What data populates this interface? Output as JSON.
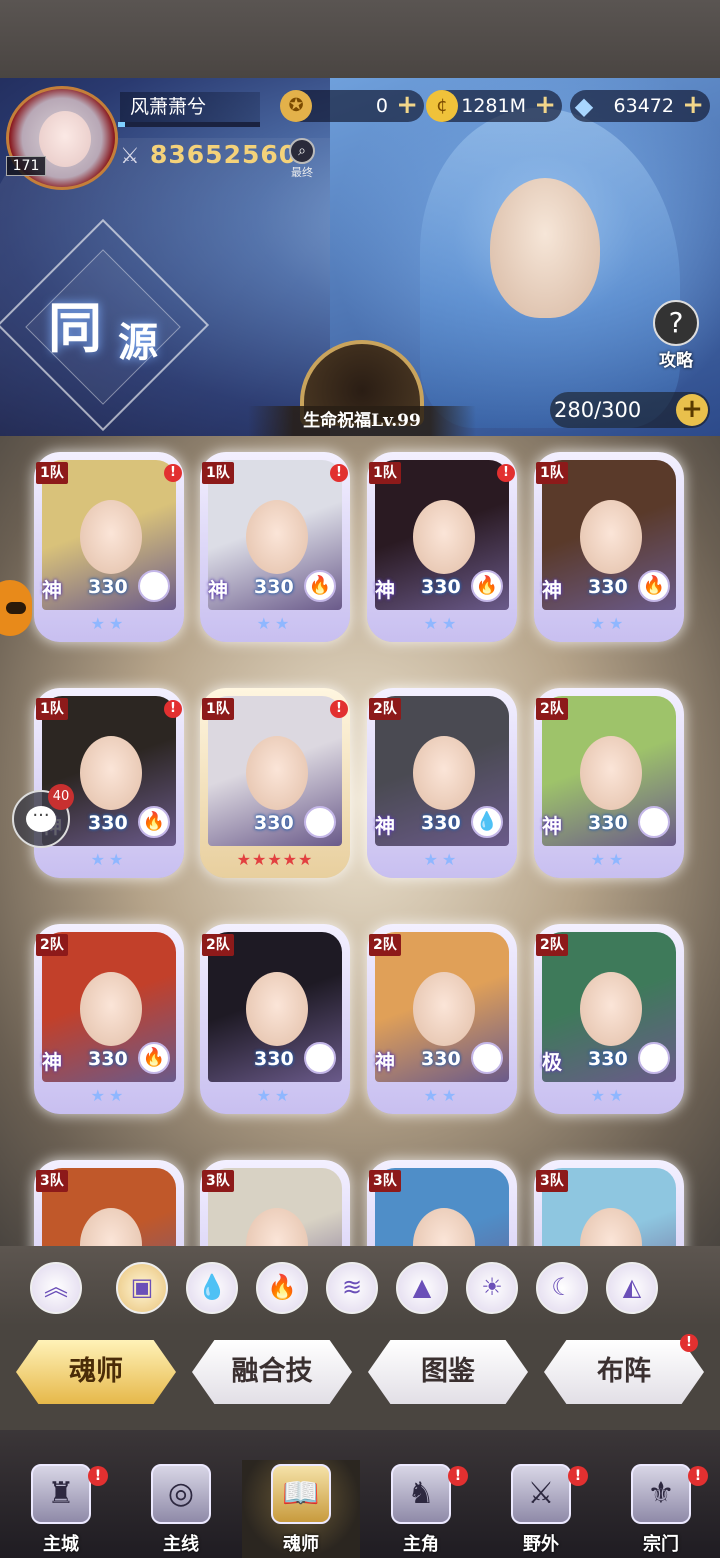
{
  "player": {
    "name": "风萧萧兮",
    "level": "171",
    "power": "83652560",
    "rank_icon": "magnifier-icon",
    "rank_label": "最终",
    "exp_progress": 0.05
  },
  "currencies": [
    {
      "icon": "medal-icon",
      "value": "0",
      "plus": "+"
    },
    {
      "icon": "gold-coin-icon",
      "value": "1281M",
      "plus": "+"
    },
    {
      "icon": "diamond-icon",
      "value": "63472",
      "plus": "+"
    }
  ],
  "banner": {
    "title_char1": "同",
    "title_char2": "源",
    "guide_label": "攻略",
    "guide_icon": "?",
    "blessing": "生命祝福Lv.99",
    "capacity": "280/300",
    "capacity_plus": "+"
  },
  "cards": [
    {
      "team": "1队",
      "grade": "神",
      "level": "330",
      "element": "sun-icon",
      "elem_glyph": "☀",
      "stars": "★★",
      "alert": "!",
      "hair": "#d9c27a"
    },
    {
      "team": "1队",
      "grade": "神",
      "level": "330",
      "element": "fire-icon",
      "elem_glyph": "🔥",
      "stars": "★★",
      "alert": "!",
      "hair": "#dcdde6"
    },
    {
      "team": "1队",
      "grade": "神",
      "level": "330",
      "element": "fire-icon",
      "elem_glyph": "🔥",
      "stars": "★★",
      "alert": "!",
      "hair": "#2a1a22"
    },
    {
      "team": "1队",
      "grade": "神",
      "level": "330",
      "element": "fire-icon",
      "elem_glyph": "🔥",
      "stars": "★★",
      "alert": "",
      "hair": "#5a3a2a"
    },
    {
      "team": "1队",
      "grade": "神",
      "level": "330",
      "element": "fire-icon",
      "elem_glyph": "🔥",
      "stars": "★★",
      "alert": "!",
      "hair": "#2c2622"
    },
    {
      "team": "1队",
      "grade": "",
      "level": "330",
      "element": "moon-icon",
      "elem_glyph": "☾",
      "stars": "★★★★★",
      "alert": "!",
      "hair": "#dcd8e0",
      "gold": true
    },
    {
      "team": "2队",
      "grade": "神",
      "level": "330",
      "element": "water-icon",
      "elem_glyph": "💧",
      "stars": "★★",
      "alert": "",
      "hair": "#4a4a52"
    },
    {
      "team": "2队",
      "grade": "神",
      "level": "330",
      "element": "wind-icon",
      "elem_glyph": "≋",
      "stars": "★★",
      "alert": "",
      "hair": "#9ec36a"
    },
    {
      "team": "2队",
      "grade": "神",
      "level": "330",
      "element": "fire-icon",
      "elem_glyph": "🔥",
      "stars": "★★",
      "alert": "",
      "hair": "#c2402a"
    },
    {
      "team": "2队",
      "grade": "",
      "level": "330",
      "element": "wind-icon",
      "elem_glyph": "≋",
      "stars": "★★",
      "alert": "",
      "hair": "#1e1a24"
    },
    {
      "team": "2队",
      "grade": "神",
      "level": "330",
      "element": "wind-icon",
      "elem_glyph": "≋",
      "stars": "★★",
      "alert": "",
      "hair": "#e0a058"
    },
    {
      "team": "2队",
      "grade": "极",
      "level": "330",
      "element": "wind-icon",
      "elem_glyph": "≋",
      "stars": "★★",
      "alert": "",
      "hair": "#3e7a5a"
    },
    {
      "team": "3队",
      "grade": "",
      "level": "",
      "element": "",
      "elem_glyph": "",
      "stars": "",
      "alert": "",
      "hair": "#c0582a"
    },
    {
      "team": "3队",
      "grade": "",
      "level": "",
      "element": "",
      "elem_glyph": "",
      "stars": "",
      "alert": "",
      "hair": "#d8d2c4"
    },
    {
      "team": "3队",
      "grade": "",
      "level": "",
      "element": "",
      "elem_glyph": "",
      "stars": "",
      "alert": "",
      "hair": "#4f8ec8"
    },
    {
      "team": "3队",
      "grade": "",
      "level": "",
      "element": "",
      "elem_glyph": "",
      "stars": "",
      "alert": "",
      "hair": "#8ec6e0"
    }
  ],
  "side": {
    "chat_icon": "chat-bubble-icon",
    "chat_count": "40",
    "chat_glyph": "···"
  },
  "filters": [
    {
      "name": "rank-chevron-icon",
      "glyph": "︽"
    },
    {
      "name": "all-box-icon",
      "glyph": "▣",
      "active": true
    },
    {
      "name": "water-filter-icon",
      "glyph": "💧"
    },
    {
      "name": "fire-filter-icon",
      "glyph": "🔥"
    },
    {
      "name": "wind-filter-icon",
      "glyph": "≋"
    },
    {
      "name": "earth-filter-icon",
      "glyph": "▲"
    },
    {
      "name": "sun-filter-icon",
      "glyph": "☀"
    },
    {
      "name": "moon-filter-icon",
      "glyph": "☾"
    },
    {
      "name": "void-filter-icon",
      "glyph": "◭"
    }
  ],
  "tabs": [
    {
      "label": "魂师",
      "active": true,
      "alert": ""
    },
    {
      "label": "融合技",
      "active": false,
      "alert": ""
    },
    {
      "label": "图鉴",
      "active": false,
      "alert": ""
    },
    {
      "label": "布阵",
      "active": false,
      "alert": "!"
    }
  ],
  "nav": [
    {
      "label": "主城",
      "icon": "castle-icon",
      "glyph": "♜",
      "alert": "!",
      "active": false
    },
    {
      "label": "主线",
      "icon": "mainline-gate-icon",
      "glyph": "◎",
      "alert": "",
      "active": false
    },
    {
      "label": "魂师",
      "icon": "book-icon",
      "glyph": "📖",
      "alert": "",
      "active": true
    },
    {
      "label": "主角",
      "icon": "hero-hood-icon",
      "glyph": "♞",
      "alert": "!",
      "active": false
    },
    {
      "label": "野外",
      "icon": "wild-sword-icon",
      "glyph": "⚔",
      "alert": "!",
      "active": false
    },
    {
      "label": "宗门",
      "icon": "sect-emblem-icon",
      "glyph": "⚜",
      "alert": "!",
      "active": false
    }
  ]
}
